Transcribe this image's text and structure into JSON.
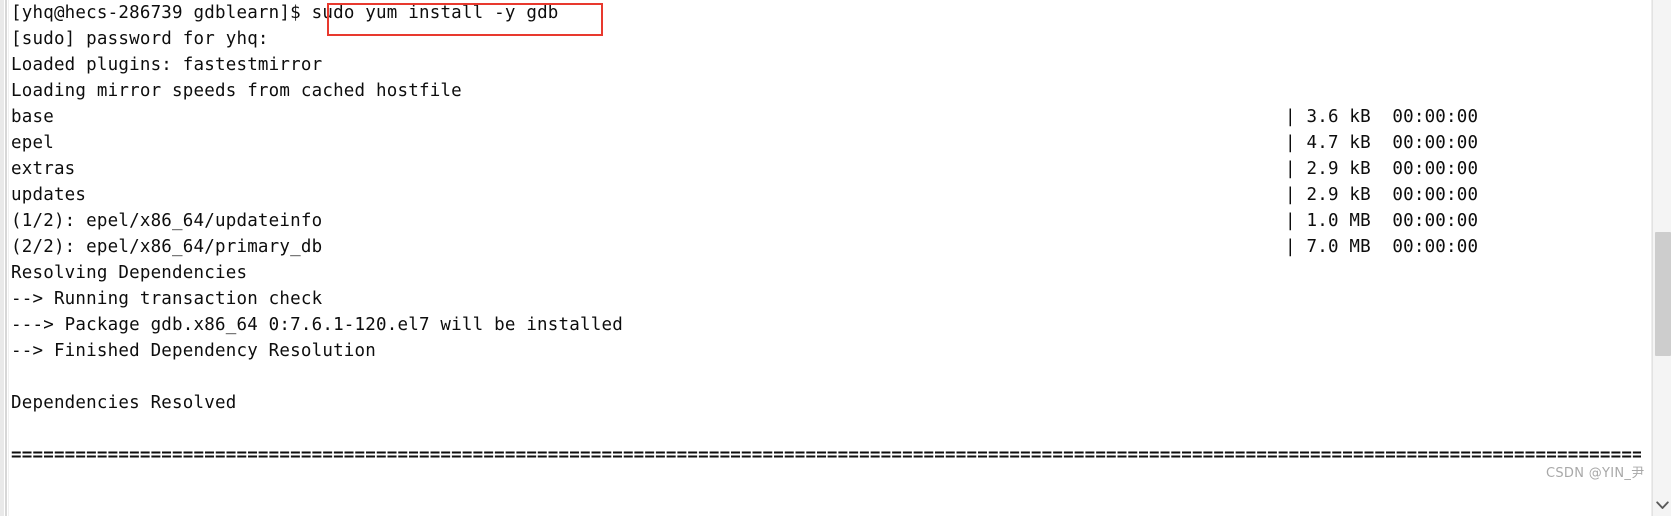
{
  "terminal": {
    "prompt_line": {
      "prompt": "[yhq@hecs-286739 gdblearn]$ ",
      "command": "sudo yum install -y gdb",
      "highlight_color": "#e8392e"
    },
    "lines": [
      {
        "left": "[sudo] password for yhq:",
        "right": ""
      },
      {
        "left": "Loaded plugins: fastestmirror",
        "right": ""
      },
      {
        "left": "Loading mirror speeds from cached hostfile",
        "right": ""
      },
      {
        "left": "base",
        "right": "| 3.6 kB  00:00:00"
      },
      {
        "left": "epel",
        "right": "| 4.7 kB  00:00:00"
      },
      {
        "left": "extras",
        "right": "| 2.9 kB  00:00:00"
      },
      {
        "left": "updates",
        "right": "| 2.9 kB  00:00:00"
      },
      {
        "left": "(1/2): epel/x86_64/updateinfo",
        "right": "| 1.0 MB  00:00:00"
      },
      {
        "left": "(2/2): epel/x86_64/primary_db",
        "right": "| 7.0 MB  00:00:00"
      },
      {
        "left": "Resolving Dependencies",
        "right": ""
      },
      {
        "left": "--> Running transaction check",
        "right": ""
      },
      {
        "left": "---> Package gdb.x86_64 0:7.6.1-120.el7 will be installed",
        "right": ""
      },
      {
        "left": "--> Finished Dependency Resolution",
        "right": ""
      },
      {
        "left": "",
        "right": ""
      },
      {
        "left": "Dependencies Resolved",
        "right": ""
      },
      {
        "left": "",
        "right": ""
      }
    ],
    "separator": "================================================================================================================================================================================================"
  },
  "watermark": {
    "text": "CSDN @YIN_尹"
  },
  "scrollbar": {
    "down_arrow_icon": "chevron-down-icon"
  }
}
